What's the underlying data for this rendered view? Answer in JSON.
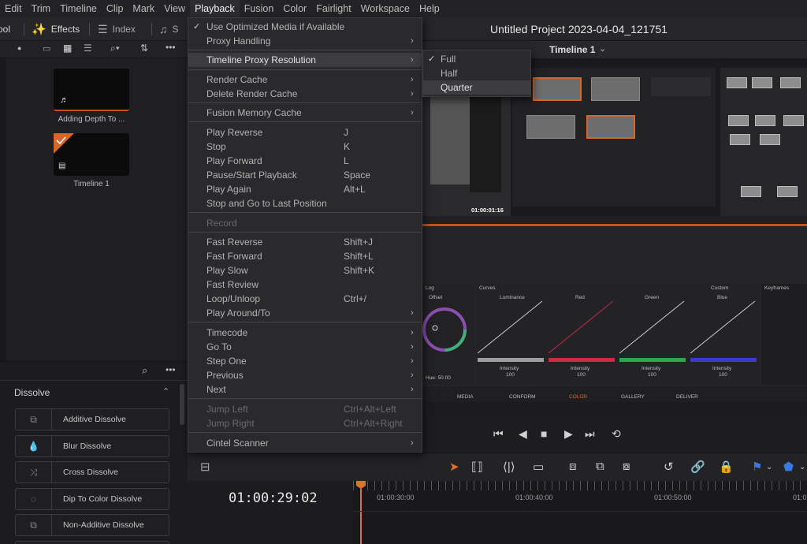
{
  "menubar": {
    "items": [
      "Edit",
      "Trim",
      "Timeline",
      "Clip",
      "Mark",
      "View",
      "Playback",
      "Fusion",
      "Color",
      "Fairlight",
      "Workspace",
      "Help"
    ]
  },
  "toolbar": {
    "pool_label": "Pool",
    "effects_label": "Effects",
    "index_label": "Index",
    "sound_label": "S",
    "project_title": "Untitled Project 2023-04-04_121751"
  },
  "viewer": {
    "timeline_label": "Timeline 1",
    "timecode_small": "01:00:01:16"
  },
  "media_pool": {
    "clips": [
      {
        "label": "Adding Depth To ..."
      },
      {
        "label": "Timeline 1"
      }
    ]
  },
  "effects": {
    "section_title": "Dissolve",
    "items": [
      {
        "label": "Additive Dissolve"
      },
      {
        "label": "Blur Dissolve"
      },
      {
        "label": "Cross Dissolve"
      },
      {
        "label": "Dip To Color Dissolve"
      },
      {
        "label": "Non-Additive Dissolve"
      }
    ]
  },
  "color_page": {
    "curves_title": "Curves",
    "custom_label": "Custom",
    "keyframes_label": "Keyframes",
    "log_label": "Log",
    "offset_label": "Offset",
    "curve_labels": [
      "Luminance",
      "Red",
      "Green",
      "Blue"
    ],
    "intensity_label": "Intensity",
    "intensity_value": "100",
    "hue_label": "Hue",
    "hue_value": "50.00",
    "page_tabs": [
      "MEDIA",
      "CONFORM",
      "COLOR",
      "GALLERY",
      "DELIVER"
    ]
  },
  "timeline": {
    "timecode": "01:00:29:02",
    "ruler_labels": [
      "01:00:30:00",
      "01:00:40:00",
      "01:00:50:00",
      "01:0"
    ]
  },
  "playback_menu": {
    "items": [
      {
        "label": "Use Optimized Media if Available",
        "checked": true
      },
      {
        "label": "Proxy Handling",
        "submenu": true
      },
      {
        "label": "Timeline Proxy Resolution",
        "submenu": true,
        "highlighted": true
      },
      {
        "label": "Render Cache",
        "submenu": true
      },
      {
        "label": "Delete Render Cache",
        "submenu": true
      },
      {
        "label": "Fusion Memory Cache",
        "submenu": true
      },
      {
        "label": "Play Reverse",
        "shortcut": "J"
      },
      {
        "label": "Stop",
        "shortcut": "K"
      },
      {
        "label": "Play Forward",
        "shortcut": "L"
      },
      {
        "label": "Pause/Start Playback",
        "shortcut": "Space"
      },
      {
        "label": "Play Again",
        "shortcut": "Alt+L"
      },
      {
        "label": "Stop and Go to Last Position"
      },
      {
        "label": "Record",
        "disabled": true
      },
      {
        "label": "Fast Reverse",
        "shortcut": "Shift+J"
      },
      {
        "label": "Fast Forward",
        "shortcut": "Shift+L"
      },
      {
        "label": "Play Slow",
        "shortcut": "Shift+K"
      },
      {
        "label": "Fast Review"
      },
      {
        "label": "Loop/Unloop",
        "shortcut": "Ctrl+/"
      },
      {
        "label": "Play Around/To",
        "submenu": true
      },
      {
        "label": "Timecode",
        "submenu": true
      },
      {
        "label": "Go To",
        "submenu": true
      },
      {
        "label": "Step One",
        "submenu": true
      },
      {
        "label": "Previous",
        "submenu": true
      },
      {
        "label": "Next",
        "submenu": true
      },
      {
        "label": "Jump Left",
        "shortcut": "Ctrl+Alt+Left",
        "disabled": true
      },
      {
        "label": "Jump Right",
        "shortcut": "Ctrl+Alt+Right",
        "disabled": true
      },
      {
        "label": "Cintel Scanner",
        "submenu": true
      }
    ]
  },
  "proxy_submenu": {
    "items": [
      {
        "label": "Full",
        "checked": true
      },
      {
        "label": "Half"
      },
      {
        "label": "Quarter",
        "highlighted": true
      }
    ]
  },
  "colors": {
    "accent": "#c2531f",
    "menu_bg": "#2a2a2d",
    "highlight": "#3b3b40"
  }
}
